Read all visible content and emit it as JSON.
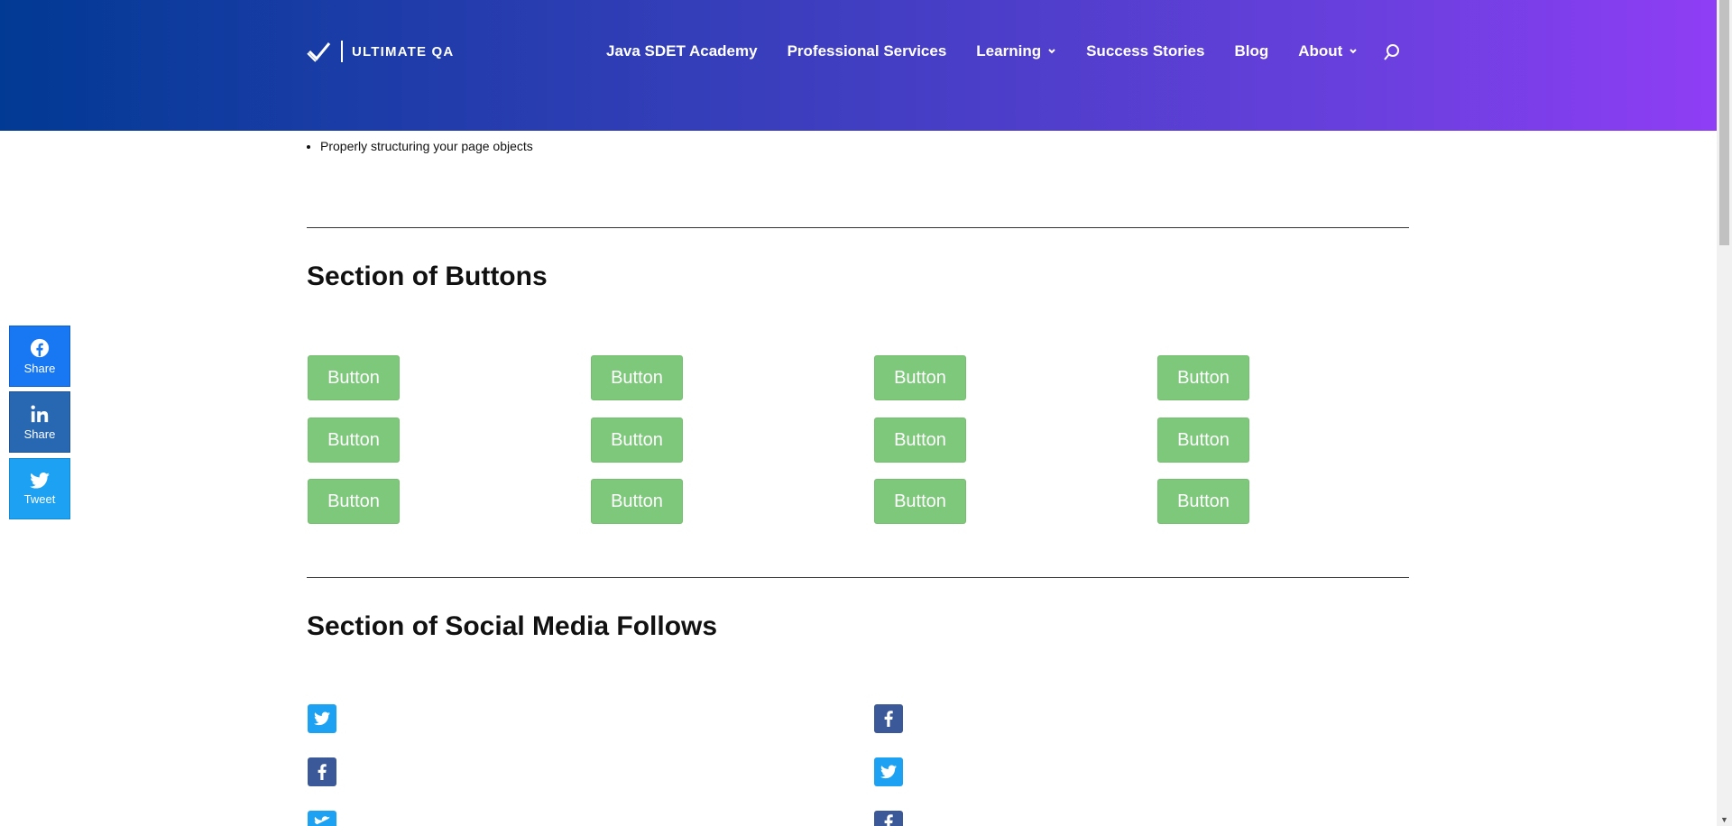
{
  "header": {
    "logo_text": "ULTIMATE QA",
    "nav": [
      {
        "label": "Java SDET Academy"
      },
      {
        "label": "Professional Services"
      },
      {
        "label": "Learning"
      },
      {
        "label": "Success Stories"
      },
      {
        "label": "Blog"
      },
      {
        "label": "About"
      }
    ]
  },
  "content": {
    "bullet_item": "Properly structuring your page objects",
    "buttons_section_title": "Section of Buttons",
    "button_label": "Button",
    "social_section_title": "Section of Social Media Follows"
  },
  "share_bar": {
    "facebook_label": "Share",
    "linkedin_label": "Share",
    "twitter_label": "Tweet"
  },
  "colors": {
    "button_green": "#7dc87a",
    "twitter_blue": "#1da1f2",
    "facebook_blue": "#3b5998",
    "linkedin_blue": "#2867b2"
  }
}
